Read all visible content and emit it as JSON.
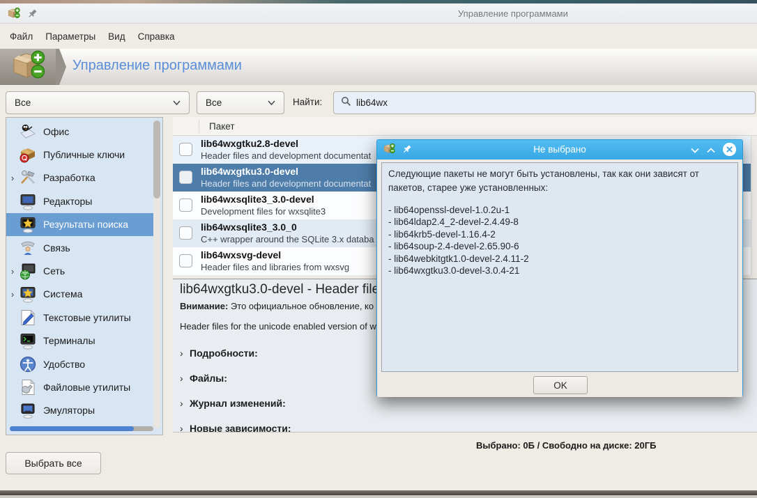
{
  "window": {
    "title": "Управление программами"
  },
  "menu": {
    "items": [
      {
        "id": "file",
        "label": "Файл"
      },
      {
        "id": "options",
        "label": "Параметры"
      },
      {
        "id": "view",
        "label": "Вид"
      },
      {
        "id": "help",
        "label": "Справка"
      }
    ]
  },
  "banner": {
    "title": "Управление программами",
    "icon": "software-manager-icon"
  },
  "filters": {
    "category_filter_value": "Все",
    "status_filter_value": "Все",
    "search_label": "Найти:",
    "search_value": "lib64wx",
    "search_icon": "magnifier-icon"
  },
  "sidebar": {
    "items": [
      {
        "label": "Офис",
        "icon": "office-icon",
        "expandable": false,
        "selected": false
      },
      {
        "label": "Публичные ключи",
        "icon": "public-keys-icon",
        "expandable": false,
        "selected": false
      },
      {
        "label": "Разработка",
        "icon": "development-icon",
        "expandable": true,
        "selected": false
      },
      {
        "label": "Редакторы",
        "icon": "editors-icon",
        "expandable": false,
        "selected": false
      },
      {
        "label": "Результаты поиска",
        "icon": "search-results-icon",
        "expandable": false,
        "selected": true
      },
      {
        "label": "Связь",
        "icon": "communications-icon",
        "expandable": false,
        "selected": false
      },
      {
        "label": "Сеть",
        "icon": "network-icon",
        "expandable": true,
        "selected": false
      },
      {
        "label": "Система",
        "icon": "system-icon",
        "expandable": true,
        "selected": false
      },
      {
        "label": "Текстовые утилиты",
        "icon": "text-tools-icon",
        "expandable": false,
        "selected": false
      },
      {
        "label": "Терминалы",
        "icon": "terminals-icon",
        "expandable": false,
        "selected": false
      },
      {
        "label": "Удобство",
        "icon": "accessibility-icon",
        "expandable": false,
        "selected": false
      },
      {
        "label": "Файловые утилиты",
        "icon": "file-tools-icon",
        "expandable": false,
        "selected": false
      },
      {
        "label": "Эмуляторы",
        "icon": "emulators-icon",
        "expandable": false,
        "selected": false
      }
    ]
  },
  "package_list": {
    "header": "Пакет",
    "rows": [
      {
        "name": "lib64wxgtku2.8-devel",
        "description": "Header files and development documentat",
        "checked": false,
        "selected": false
      },
      {
        "name": "lib64wxgtku3.0-devel",
        "description": "Header files and development documentat",
        "checked": false,
        "selected": true
      },
      {
        "name": "lib64wxsqlite3_3.0-devel",
        "description": "Development files for wxsqlite3",
        "checked": false,
        "selected": false
      },
      {
        "name": "lib64wxsqlite3_3.0_0",
        "description": "C++ wrapper around the SQLite 3.x databa",
        "checked": false,
        "selected": false
      },
      {
        "name": "lib64wxsvg-devel",
        "description": "Header files and libraries from wxsvg",
        "checked": false,
        "selected": false
      }
    ]
  },
  "details": {
    "title": "lib64wxgtku3.0-devel - Header file",
    "warning_label": "Внимание:",
    "warning_text": " Это официальное обновление, ко",
    "summary": "Header files for the unicode enabled version of w",
    "sections": [
      {
        "label": "Подробности:"
      },
      {
        "label": "Файлы:"
      },
      {
        "label": "Журнал изменений:"
      },
      {
        "label": "Новые зависимости:"
      }
    ]
  },
  "status": {
    "selected_text": "Выбрано: 0Б / Свободно на диске: 20ГБ"
  },
  "actions": {
    "select_all_label": "Выбрать все"
  },
  "dialog": {
    "title": "Не выбрано",
    "message": "Следующие пакеты не могут быть установлены, так как они зависят от пакетов, старее уже установленных:",
    "packages": [
      "- lib64openssl-devel-1.0.2u-1",
      "- lib64ldap2.4_2-devel-2.4.49-8",
      "- lib64krb5-devel-1.16.4-2",
      "- lib64soup-2.4-devel-2.65.90-6",
      "- lib64webkitgtk1.0-devel-2.4.11-2",
      "- lib64wxgtku3.0-devel-3.0.4-21"
    ],
    "ok_label": "OK"
  },
  "colors": {
    "dialog_titlebar": "#41b0e8",
    "package_selection": "#4e7da9",
    "sidebar_selection": "#6a9ed2",
    "banner_title_blue": "#5a8ed8",
    "sidebar_background": "#d8e5f2",
    "scrollbar_accent": "#4d82d2"
  }
}
